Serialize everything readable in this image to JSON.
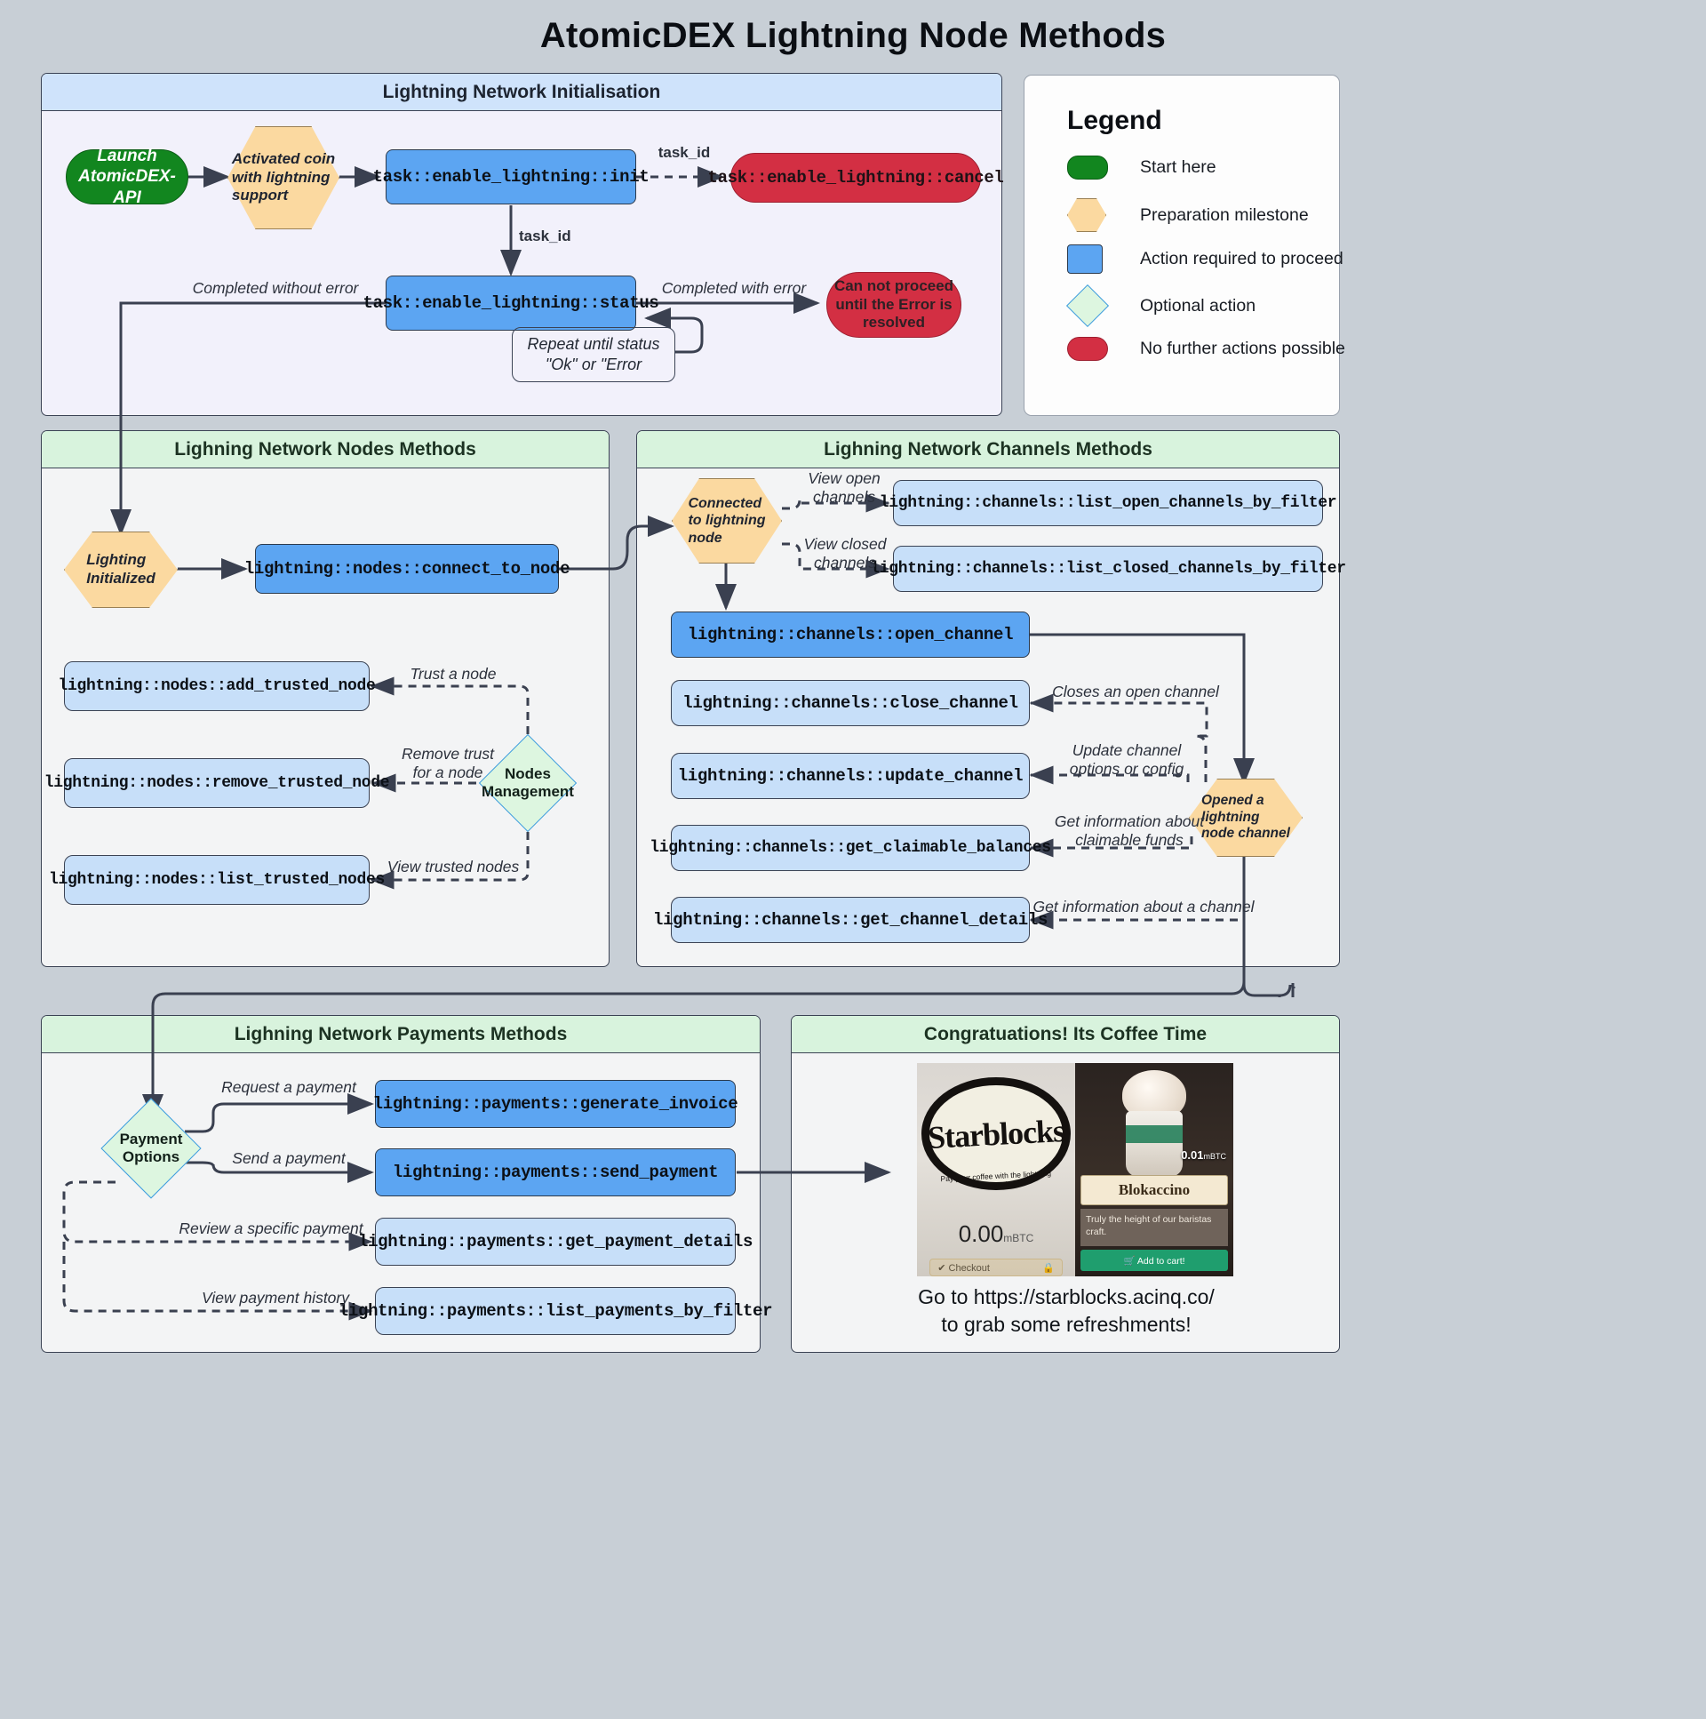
{
  "title": "AtomicDEX Lightning Node Methods",
  "clusters": {
    "init": "Lightning Network Initialisation",
    "nodes": "Lighning Network Nodes Methods",
    "channels": "Lighning Network Channels Methods",
    "payments": "Lighning Network Payments Methods",
    "coffee": "Congratuations! Its Coffee Time"
  },
  "legend": {
    "heading": "Legend",
    "items": [
      {
        "shape": "start-pill-icon",
        "color": "#12861f",
        "label": "Start here"
      },
      {
        "shape": "hexagon-icon",
        "color": "#fbd9a0",
        "label": "Preparation milestone"
      },
      {
        "shape": "rectangle-icon",
        "color": "#5ca5f2",
        "label": "Action required to proceed"
      },
      {
        "shape": "diamond-icon",
        "color": "#ddf6e0",
        "label": "Optional action"
      },
      {
        "shape": "stop-pill-icon",
        "color": "#d32f43",
        "label": "No further actions possible"
      }
    ]
  },
  "init_section": {
    "launch": "Launch\nAtomicDEX-API",
    "activated_coin": "Activated coin\nwith lightning\nsupport",
    "enable_init": "task::enable_lightning::init",
    "enable_cancel": "task::enable_lightning::cancel",
    "enable_status": "task::enable_lightning::status",
    "error_box": "Can not proceed\nuntil the Error is\nresolved",
    "repeat_note": "Repeat until status\n\"Ok\" or \"Error",
    "lbl_task_id_1": "task_id",
    "lbl_task_id_2": "task_id",
    "lbl_completed_without": "Completed without error",
    "lbl_completed_with": "Completed with error"
  },
  "nodes_section": {
    "lighting_initialized": "Lighting\nInitialized",
    "connect_to_node": "lightning::nodes::connect_to_node",
    "add_trusted_node": "lightning::nodes::add_trusted_node",
    "remove_trusted_node": "lightning::nodes::remove_trusted_node",
    "list_trusted_nodes": "lightning::nodes::list_trusted_nodes",
    "nodes_management": "Nodes\nManagement",
    "lbl_trust": "Trust a node",
    "lbl_remove_trust": "Remove trust\nfor a node",
    "lbl_view_trusted": "View trusted nodes"
  },
  "channels_section": {
    "connected": "Connected\nto lightning\nnode",
    "list_open": "lightning::channels::list_open_channels_by_filter",
    "list_closed": "lightning::channels::list_closed_channels_by_filter",
    "open_channel": "lightning::channels::open_channel",
    "close_channel": "lightning::channels::close_channel",
    "update_channel": "lightning::channels::update_channel",
    "get_claimable_balances": "lightning::channels::get_claimable_balances",
    "get_channel_details": "lightning::channels::get_channel_details",
    "opened_channel": "Opened a\nlightning\nnode channel",
    "lbl_view_open": "View open\nchannels",
    "lbl_view_closed": "View closed\nchannels",
    "lbl_closes_open": "Closes an open channel",
    "lbl_update_opts": "Update channel\noptions or config",
    "lbl_get_claimable": "Get information about\nclaimable funds",
    "lbl_get_channel": "Get information about a channel"
  },
  "payments_section": {
    "payment_options": "Payment\nOptions",
    "generate_invoice": "lightning::payments::generate_invoice",
    "send_payment": "lightning::payments::send_payment",
    "get_payment_details": "lightning::payments::get_payment_details",
    "list_payments": "lightning::payments::list_payments_by_filter",
    "lbl_request": "Request a payment",
    "lbl_send": "Send a payment",
    "lbl_review": "Review a specific payment",
    "lbl_history": "View payment history"
  },
  "coffee_section": {
    "brand": "Starblocks",
    "brand_tagline": "Pay your coffee with the lightning network",
    "amount": "0.00",
    "amount_unit": "mBTC",
    "checkout": "✔ Checkout",
    "price": "0.01",
    "price_unit": "mBTC",
    "product": "Blokaccino",
    "product_desc": "Truly the height of our baristas craft.",
    "add_to_cart": "🛒 Add to cart!",
    "caption": "Go to https://starblocks.acinq.co/\nto grab some refreshments!"
  }
}
